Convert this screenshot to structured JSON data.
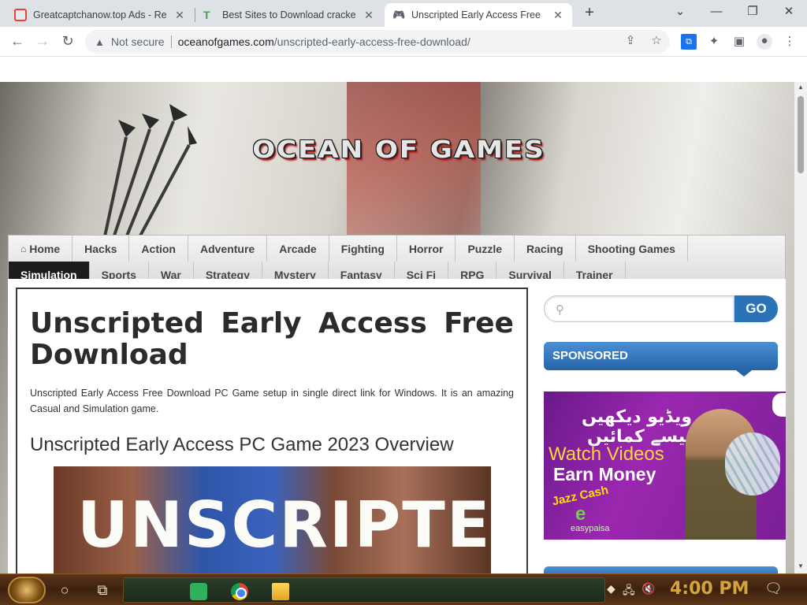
{
  "browser": {
    "tabs": [
      {
        "title": "Greatcaptchanow.top Ads - Re",
        "active": false
      },
      {
        "title": "Best Sites to Download cracke",
        "active": false
      },
      {
        "title": "Unscripted Early Access Free",
        "active": true
      }
    ],
    "new_tab": "+",
    "window_controls": {
      "list": "⌄",
      "minimize": "—",
      "restore": "❐",
      "close": "✕"
    },
    "security_label": "Not secure",
    "url_domain": "oceanofgames.com",
    "url_path": "/unscripted-early-access-free-download/"
  },
  "site": {
    "logo": "OCEAN OF GAMES",
    "menu_row1": [
      {
        "label": "Home",
        "icon": "home-icon"
      },
      {
        "label": "Hacks"
      },
      {
        "label": "Action"
      },
      {
        "label": "Adventure"
      },
      {
        "label": "Arcade"
      },
      {
        "label": "Fighting"
      },
      {
        "label": "Horror"
      },
      {
        "label": "Puzzle"
      },
      {
        "label": "Racing"
      },
      {
        "label": "Shooting Games"
      }
    ],
    "menu_row2": [
      {
        "label": "Simulation",
        "active": true
      },
      {
        "label": "Sports"
      },
      {
        "label": "War"
      },
      {
        "label": "Strategy"
      },
      {
        "label": "Mystery"
      },
      {
        "label": "Fantasy"
      },
      {
        "label": "Sci Fi"
      },
      {
        "label": "RPG"
      },
      {
        "label": "Survival"
      },
      {
        "label": "Trainer"
      }
    ]
  },
  "article": {
    "title_line1_words": [
      "Unscripted",
      "Early",
      "Access",
      "Free"
    ],
    "title_line2": "Download",
    "intro": "Unscripted Early Access Free Download PC Game setup in single direct link for Windows. It is an amazing Casual and Simulation game.",
    "overview_heading": "Unscripted Early Access PC Game 2023 Overview",
    "image_text": "UNSCRIPTED"
  },
  "sidebar": {
    "search_placeholder": "",
    "search_button": "GO",
    "sponsored_label": "SPONSORED",
    "ad": {
      "urdu_text": "ویڈیو دیکھیں پیسے کمائیں",
      "line1": "Watch Videos",
      "line2": "Earn Money",
      "brand1": "Jazz Cash",
      "brand2": "e",
      "brand3": "easypaisa"
    }
  },
  "taskbar": {
    "clock": "4:00 PM"
  },
  "colors": {
    "accent_blue": "#2a73b8",
    "menu_active": "#1c1c1c",
    "clock": "#d4a63a"
  }
}
